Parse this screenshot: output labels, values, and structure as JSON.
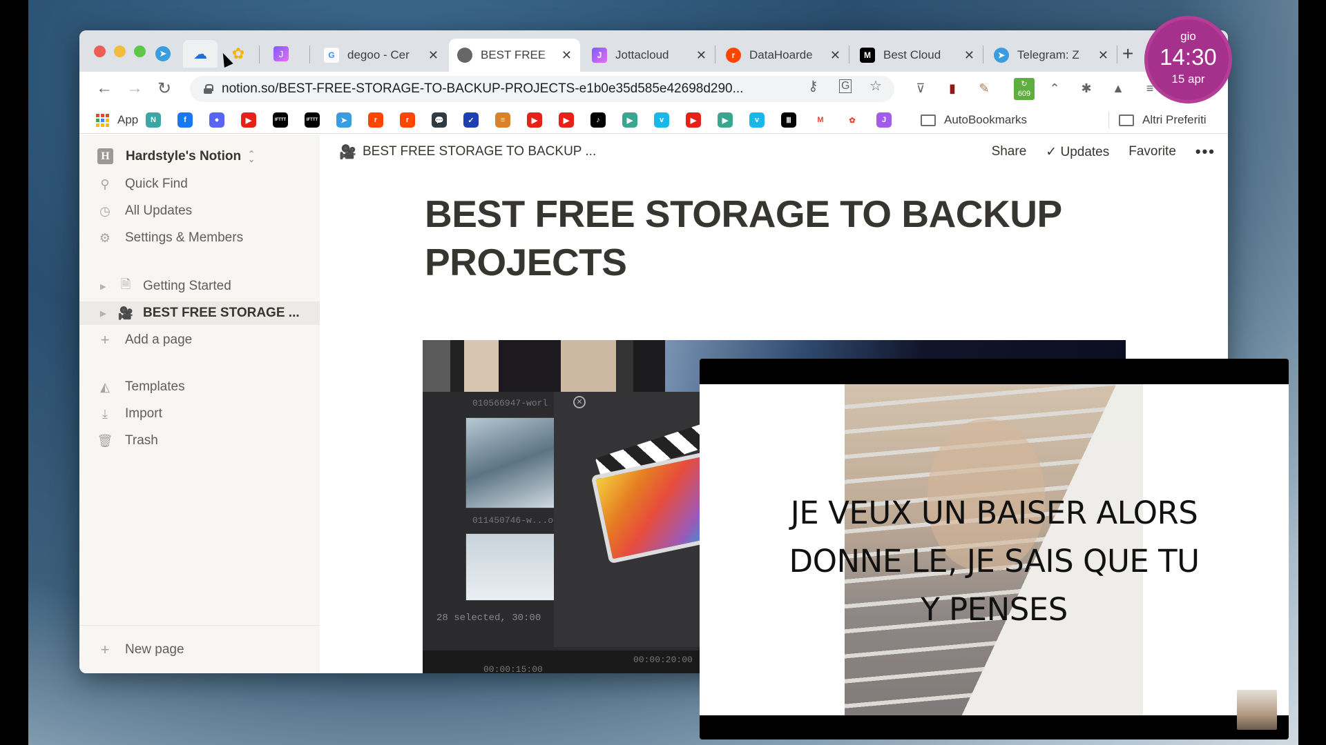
{
  "browser": {
    "pinned_tabs": [
      {
        "name": "telegram",
        "icon": "telegram-icon",
        "color": "#3a9de0"
      },
      {
        "name": "cloud-upload",
        "icon": "cloud-upload-icon",
        "color": "#1e6fd9"
      },
      {
        "name": "google-photos",
        "icon": "google-photos-icon",
        "color": "#f4b400"
      },
      {
        "name": "jottacloud",
        "icon": "jottacloud-icon",
        "color": "#a35bea"
      }
    ],
    "tabs": [
      {
        "title": "degoo - Cer",
        "favicon": "G",
        "favicon_color": "#4285f4",
        "icon": "google-icon",
        "active": false
      },
      {
        "title": "BEST FREE",
        "favicon": "🎥",
        "favicon_color": "#555555",
        "icon": "movie-camera-icon",
        "active": true
      },
      {
        "title": "Jottacloud",
        "favicon": "J",
        "favicon_color": "#a35bea",
        "icon": "jottacloud-icon",
        "active": false
      },
      {
        "title": "DataHoarde",
        "favicon": "r",
        "favicon_color": "#ff4500",
        "icon": "reddit-icon",
        "active": false
      },
      {
        "title": "Best Cloud",
        "favicon": "M",
        "favicon_color": "#000000",
        "icon": "medium-icon",
        "active": false
      },
      {
        "title": "Telegram: Z",
        "favicon": "➤",
        "favicon_color": "#3a9de0",
        "icon": "telegram-icon",
        "active": false
      }
    ],
    "close_glyph": "✕",
    "new_tab_glyph": "+",
    "url": "notion.so/BEST-FREE-STORAGE-TO-BACKUP-PROJECTS-e1b0e35d585e42698d290...",
    "extension_badge": "609",
    "bookmarks": {
      "apps_label": "App",
      "icons": [
        {
          "name": "notion-n",
          "color": "#3aa6a6",
          "glyph": "N"
        },
        {
          "name": "facebook",
          "color": "#1877f2",
          "glyph": "f"
        },
        {
          "name": "discord-record",
          "color": "#5865f2",
          "glyph": "●"
        },
        {
          "name": "youtube",
          "color": "#e62117",
          "glyph": "▶"
        },
        {
          "name": "ifttt",
          "color": "#000000",
          "glyph": "IFTTT"
        },
        {
          "name": "ifttt",
          "color": "#000000",
          "glyph": "IFTTT"
        },
        {
          "name": "telegram",
          "color": "#3a9de0",
          "glyph": "➤"
        },
        {
          "name": "reddit",
          "color": "#ff4500",
          "glyph": "r"
        },
        {
          "name": "reddit",
          "color": "#ff4500",
          "glyph": "r"
        },
        {
          "name": "messages",
          "color": "#2f3b45",
          "glyph": "💬"
        },
        {
          "name": "bird",
          "color": "#1e3fb0",
          "glyph": "✓"
        },
        {
          "name": "document",
          "color": "#d9822b",
          "glyph": "≡"
        },
        {
          "name": "youtube-studio",
          "color": "#e62117",
          "glyph": "▶"
        },
        {
          "name": "youtube",
          "color": "#e62117",
          "glyph": "▶"
        },
        {
          "name": "tiktok",
          "color": "#000000",
          "glyph": "♪"
        },
        {
          "name": "play",
          "color": "#3aa68f",
          "glyph": "▶"
        },
        {
          "name": "vimeo",
          "color": "#1ab7ea",
          "glyph": "v"
        },
        {
          "name": "youtube",
          "color": "#e62117",
          "glyph": "▶"
        },
        {
          "name": "play",
          "color": "#3aa68f",
          "glyph": "▶"
        },
        {
          "name": "vimeo",
          "color": "#1ab7ea",
          "glyph": "v"
        },
        {
          "name": "archive",
          "color": "#000000",
          "glyph": "Ⅲ"
        },
        {
          "name": "gmail",
          "color": "#ffffff",
          "glyph": "M"
        },
        {
          "name": "google-photos",
          "color": "#ffffff",
          "glyph": "✿"
        },
        {
          "name": "jottacloud",
          "color": "#a35bea",
          "glyph": "J"
        }
      ],
      "folder_1": "AutoBookmarks",
      "folder_2": "Altri Preferiti"
    }
  },
  "notion": {
    "workspace": {
      "initial": "H",
      "name": "Hardstyle's Notion"
    },
    "nav": [
      {
        "label": "Quick Find",
        "icon": "search-icon"
      },
      {
        "label": "All Updates",
        "icon": "clock-icon"
      },
      {
        "label": "Settings & Members",
        "icon": "gear-icon"
      }
    ],
    "pages": [
      {
        "label": "Getting Started",
        "icon": "document-icon",
        "selected": false
      },
      {
        "label": "BEST FREE STORAGE ...",
        "icon": "movie-camera-icon",
        "selected": true
      }
    ],
    "add_page": "Add a page",
    "tools": [
      {
        "label": "Templates",
        "icon": "templates-icon"
      },
      {
        "label": "Import",
        "icon": "import-icon"
      },
      {
        "label": "Trash",
        "icon": "trash-icon"
      }
    ],
    "new_page": "New page",
    "topbar": {
      "breadcrumb": "BEST FREE STORAGE TO BACKUP ...",
      "share": "Share",
      "updates": "Updates",
      "favorite": "Favorite",
      "more": "•••"
    },
    "page_title_line1": "BEST FREE STORAGE TO BACKUP",
    "page_title_line2": "PROJECTS",
    "embed_captions": {
      "clip1": "010566947-worl",
      "clip2": "011450746-w...o",
      "selection": "28 selected, 30:00",
      "tc1": "00:00:15:00",
      "tc2": "00:00:20:00"
    }
  },
  "video": {
    "lyrics": [
      "JE VEUX UN BAISER ALORS",
      "DONNE LE, JE SAIS QUE TU",
      "Y PENSES"
    ]
  },
  "clock": {
    "day": "gio",
    "time": "14:30",
    "date": "15 apr",
    "color": "#a6318c"
  }
}
